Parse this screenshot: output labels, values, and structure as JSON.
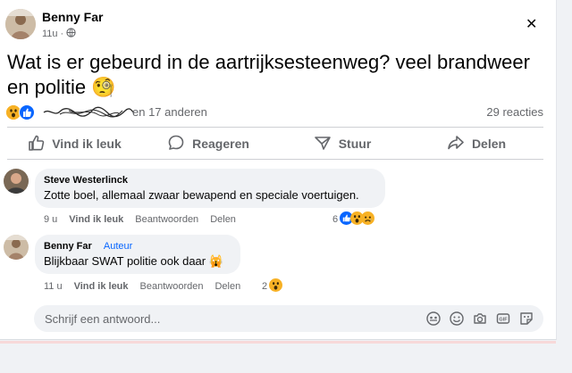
{
  "post": {
    "author": "Benny Far",
    "time": "11u",
    "visibility_icon": "globe-icon",
    "text": "Wat is er gebeurd in de aartrijksesteenweg? veel brandweer en politie",
    "text_emoji": "🧐",
    "reaction_names_suffix": "en 17 anderen",
    "reaction_total": "29 reacties"
  },
  "actions": {
    "like": "Vind ik leuk",
    "comment": "Reageren",
    "share": "Stuur",
    "forward": "Delen"
  },
  "comments": [
    {
      "author": "Steve Westerlinck",
      "text": "Zotte boel, allemaal zwaar bewapend en speciale voertuigen.",
      "time": "9 u",
      "like": "Vind ik leuk",
      "reply": "Beantwoorden",
      "share": "Delen",
      "reaction_count": "6"
    },
    {
      "author": "Benny Far",
      "badge": "Auteur",
      "text": "Blijkbaar SWAT politie ook daar",
      "text_emoji": "🙀",
      "time": "11 u",
      "like": "Vind ik leuk",
      "reply": "Beantwoorden",
      "share": "Delen",
      "reaction_count": "2"
    }
  ],
  "reply_box": {
    "placeholder": "Schrijf een antwoord..."
  },
  "colors": {
    "like_blue": "#0866ff",
    "wow_yellow": "#f7b125",
    "muted_text": "#65676b"
  }
}
